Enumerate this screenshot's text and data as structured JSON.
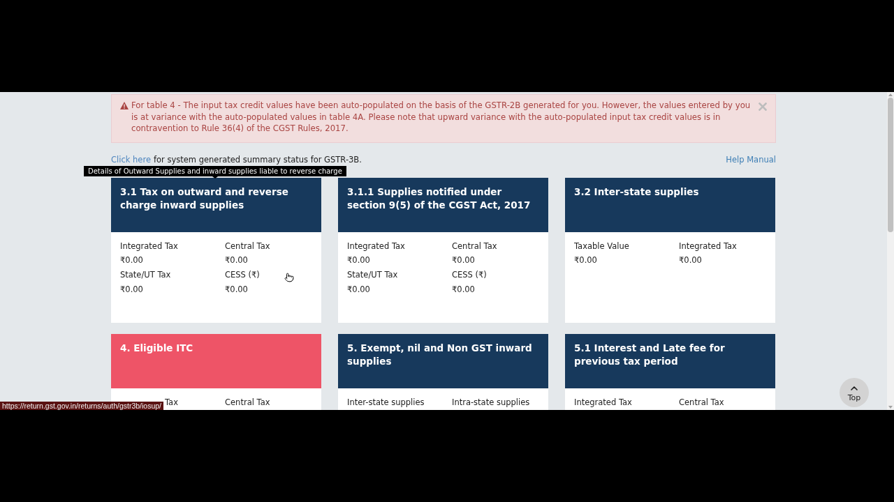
{
  "alert": {
    "message": "For table 4 - The input tax credit values have been auto-populated on the basis of the GSTR-2B generated for you. However, the values entered by you is at variance with the auto-populated values in table 4A. Please note that upward variance with the auto-populated input tax credit values is in contravention to Rule 36(4) of the CGST Rules, 2017.",
    "dismissible": true
  },
  "summary_link": {
    "link": "Click here",
    "text": "for system generated summary status for GSTR-3B."
  },
  "help_link": "Help Manual",
  "tooltip": "Details of Outward Supplies and inward supplies liable to reverse charge",
  "cards": [
    {
      "title": "3.1 Tax on outward and reverse charge inward supplies",
      "color": "#17395c",
      "fields": [
        {
          "label": "Integrated Tax",
          "value": "₹0.00"
        },
        {
          "label": "Central Tax",
          "value": "₹0.00"
        },
        {
          "label": "State/UT Tax",
          "value": "₹0.00"
        },
        {
          "label": "CESS (₹)",
          "value": "₹0.00"
        }
      ]
    },
    {
      "title": "3.1.1 Supplies notified under section 9(5) of the CGST Act, 2017",
      "color": "#17395c",
      "fields": [
        {
          "label": "Integrated Tax",
          "value": "₹0.00"
        },
        {
          "label": "Central Tax",
          "value": "₹0.00"
        },
        {
          "label": "State/UT Tax",
          "value": "₹0.00"
        },
        {
          "label": "CESS (₹)",
          "value": "₹0.00"
        }
      ]
    },
    {
      "title": "3.2 Inter-state supplies",
      "color": "#17395c",
      "fields": [
        {
          "label": "Taxable Value",
          "value": "₹0.00"
        },
        {
          "label": "Integrated Tax",
          "value": "₹0.00"
        }
      ]
    },
    {
      "title": "4. Eligible ITC",
      "color": "#ee5467",
      "fields": [
        {
          "label": "Tax",
          "clipped": true
        },
        {
          "label": "Central Tax"
        }
      ]
    },
    {
      "title": "5. Exempt, nil and Non GST inward supplies",
      "color": "#17395c",
      "fields": [
        {
          "label": "Inter-state supplies"
        },
        {
          "label": "Intra-state supplies"
        }
      ]
    },
    {
      "title": "5.1 Interest and Late fee for previous tax period",
      "color": "#17395c",
      "fields": [
        {
          "label": "Integrated Tax"
        },
        {
          "label": "Central Tax"
        }
      ]
    }
  ],
  "back_to_top": "Top",
  "status_bar": {
    "url": "https://return.gst.gov.in/returns/auth/gstr3b/iosup/"
  }
}
